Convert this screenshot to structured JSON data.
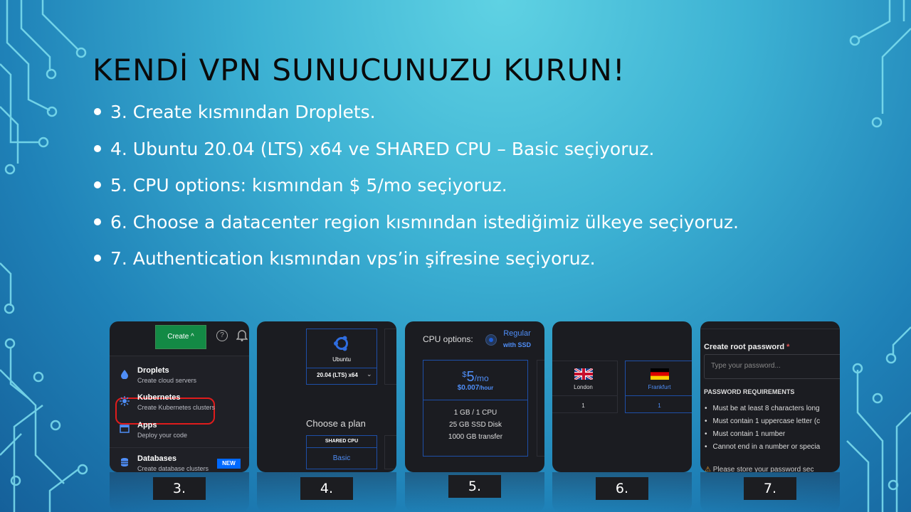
{
  "slide": {
    "title": "KENDİ VPN SUNUCUNUZU KURUN!",
    "bullets": [
      "3. Create kısmından Droplets.",
      "4. Ubuntu 20.04 (LTS) x64 ve SHARED CPU – Basic seçiyoruz.",
      "5. CPU options: kısmından $ 5/mo seçiyoruz.",
      "6. Choose a datacenter region kısmından istediğimiz ülkeye seçiyoruz.",
      "7. Authentication kısmından vps’in şifresine seçiyoruz."
    ]
  },
  "step_labels": [
    "3.",
    "4.",
    "5.",
    "6.",
    "7."
  ],
  "shot3": {
    "create_button": "Create ^",
    "help_icon": "?",
    "menu": [
      {
        "title": "Droplets",
        "desc": "Create cloud servers",
        "icon": "droplet-icon"
      },
      {
        "title": "Kubernetes",
        "desc": "Create Kubernetes clusters",
        "icon": "kubernetes-icon"
      },
      {
        "title": "Apps",
        "desc": "Deploy your code",
        "icon": "apps-icon"
      },
      {
        "title": "Databases",
        "desc": "Create database clusters",
        "icon": "database-icon"
      }
    ],
    "new_badge": "NEW"
  },
  "shot4": {
    "distro": "Ubuntu",
    "version": "20.04 (LTS) x64",
    "choose_plan": "Choose a plan",
    "shared_cpu": "SHARED CPU",
    "basic": "Basic"
  },
  "shot5": {
    "cpu_options": "CPU options:",
    "regular_1": "Regular",
    "regular_2": "with SSD",
    "price_dollar": "$",
    "price_main": "5",
    "price_unit": "/mo",
    "price_hour": "$0.007",
    "price_hour_unit": "/hour",
    "specs": [
      "1 GB / 1 CPU",
      "25 GB SSD Disk",
      "1000 GB transfer"
    ]
  },
  "shot6": {
    "regions": [
      {
        "name": "London",
        "count": "1",
        "flag": "uk-flag"
      },
      {
        "name": "Frankfurt",
        "count": "1",
        "flag": "germany-flag"
      }
    ]
  },
  "shot7": {
    "create_root_password": "Create root password",
    "required_mark": "*",
    "placeholder": "Type your password...",
    "requirements_title": "PASSWORD REQUIREMENTS",
    "requirements": [
      "Must be at least 8 characters long",
      "Must contain 1 uppercase letter (c",
      "Must contain 1 number",
      "Cannot end in a number or specia"
    ],
    "store_note": "Please store your password sec"
  },
  "colors": {
    "accent_blue": "#4f8ef7",
    "create_green": "#138a45",
    "highlight_red": "#e01c1c"
  }
}
